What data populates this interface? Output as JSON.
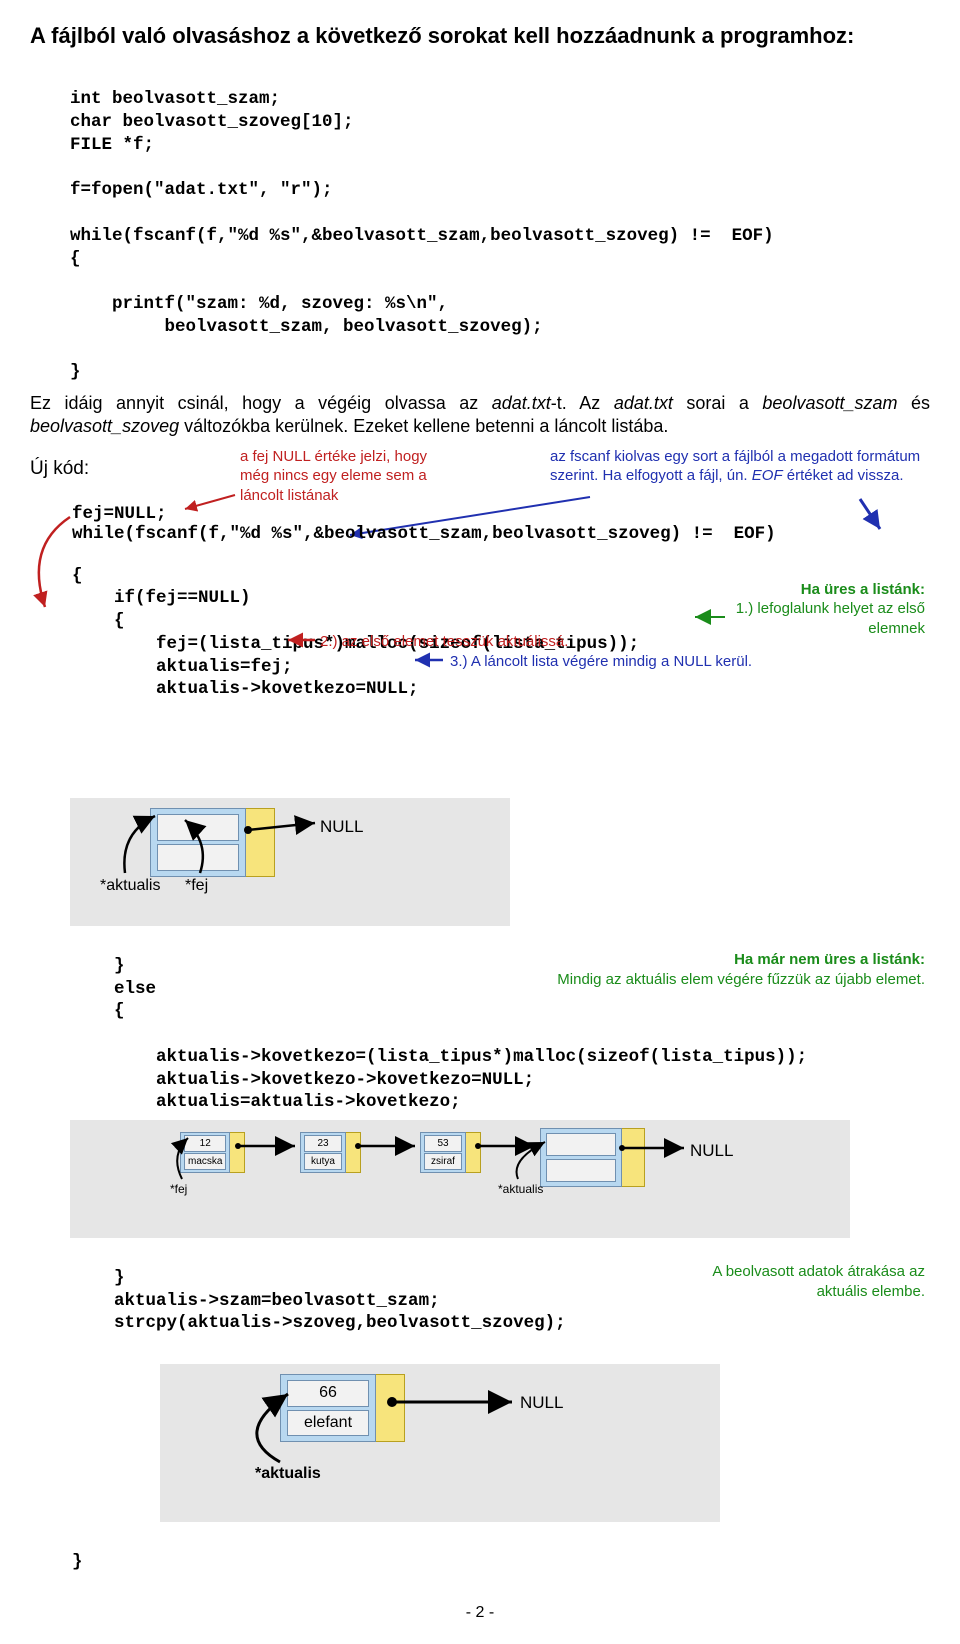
{
  "heading": "A fájlból való olvasáshoz a következő sorokat kell hozzáadnunk a programhoz:",
  "code1a": "int beolvasott_szam;",
  "code1b": "char beolvasott_szoveg[10];",
  "code1c": "FILE *f;",
  "code1d": "f=fopen(\"adat.txt\", \"r\");",
  "code1e": "while(fscanf(f,\"%d %s\",&beolvasott_szam,beolvasott_szoveg) !=  EOF)",
  "code1f": "{",
  "code1g": "    printf(\"szam: %d, szoveg: %s\\n\",",
  "code1h": "         beolvasott_szam, beolvasott_szoveg);",
  "code1i": "}",
  "para1a": "Ez idáig annyit csinál, hogy a végéig olvassa az ",
  "para1b": "adat.txt",
  "para1c": "-t. Az ",
  "para1d": "adat.txt",
  "para1e": " sorai a ",
  "para1f": "beolvasott_szam",
  "para1g": " és ",
  "para1h": "beolvasott_szoveg",
  "para1i": " változókba kerülnek. Ezeket kellene betenni a láncolt listába.",
  "ujkod": "Új kód:",
  "annot_fej": "a fej NULL értéke jelzi, hogy még nincs egy eleme sem a láncolt listának",
  "annot_fscanf_a": "az fscanf kiolvas egy sort a fájlból a megadott formátum szerint. Ha elfogyott a fájl, ún. ",
  "annot_fscanf_b": "EOF",
  "annot_fscanf_c": " értéket ad vissza.",
  "code2a": "    fej=NULL;",
  "code2b": "    while(fscanf(f,\"%d %s\",&beolvasott_szam,beolvasott_szoveg) !=  EOF)",
  "code2c": "    {",
  "code2d": "        if(fej==NULL)",
  "code2e": "        {",
  "code2f": "            fej=(lista_tipus*)malloc(sizeof(lista_tipus));",
  "code2g": "            aktualis=fej;",
  "code2h": "            aktualis->kovetkezo=NULL;",
  "annot_malloc1": "Ha üres a listánk:",
  "annot_malloc2": "1.) lefoglalunk helyet az első elemnek",
  "annot_step2": "2.) az első elemet tesszük aktuálissá.",
  "annot_step3": "3.) A láncolt lista végére mindig a NULL kerül.",
  "diag1_null": "NULL",
  "diag1_aktualis": "*aktualis",
  "diag1_fej": "*fej",
  "code3a": "        }",
  "code3b": "        else",
  "code3c": "        {",
  "annot_else1": "Ha már nem üres a listánk:",
  "annot_else2": "Mindig az aktuális elem végére fűzzük az újabb elemet.",
  "code3d": "            aktualis->kovetkezo=(lista_tipus*)malloc(sizeof(lista_tipus));",
  "code3e": "            aktualis->kovetkezo->kovetkezo=NULL;",
  "code3f": "            aktualis=aktualis->kovetkezo;",
  "diag2_n1a": "12",
  "diag2_n1b": "macska",
  "diag2_n2a": "23",
  "diag2_n2b": "kutya",
  "diag2_n3a": "53",
  "diag2_n3b": "zsiraf",
  "diag2_null": "NULL",
  "diag2_fej": "*fej",
  "diag2_akt": "*aktualis",
  "code4a": "        }",
  "code4b": "        aktualis->szam=beolvasott_szam;",
  "code4c": "        strcpy(aktualis->szoveg,beolvasott_szoveg);",
  "annot_copy1": "A beolvasott adatok átrakása az aktuális elembe.",
  "diag3_n1a": "66",
  "diag3_n1b": "elefant",
  "diag3_null": "NULL",
  "diag3_akt": "*aktualis",
  "code5a": "    }",
  "page": "- 2 -"
}
